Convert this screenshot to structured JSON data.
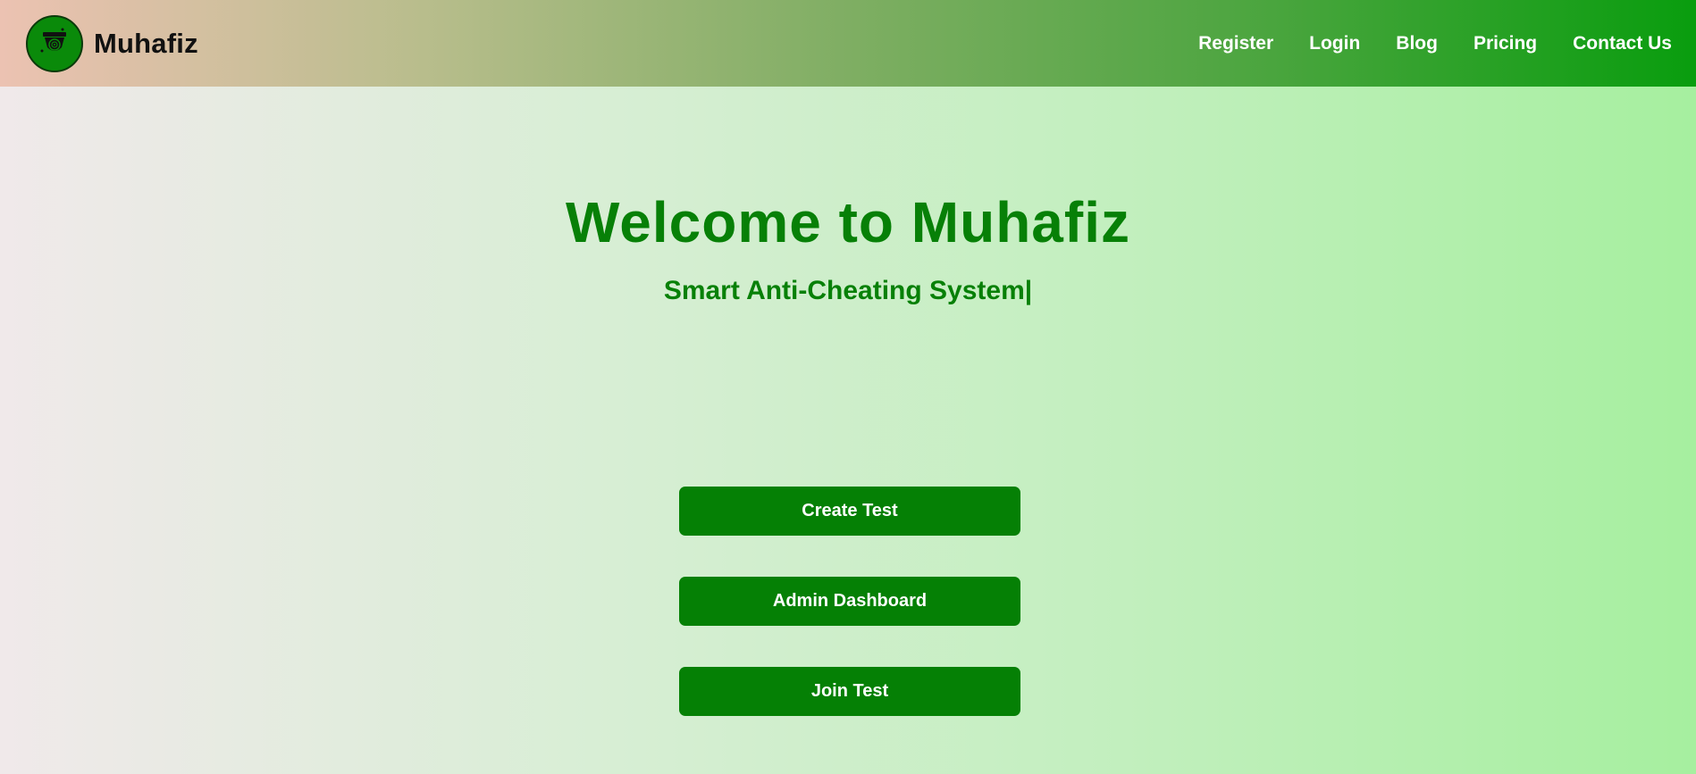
{
  "navbar": {
    "brand_name": "Muhafiz",
    "logo_icon": "camera-surveillance-icon",
    "links": [
      {
        "label": "Register"
      },
      {
        "label": "Login"
      },
      {
        "label": "Blog"
      },
      {
        "label": "Pricing"
      },
      {
        "label": "Contact Us"
      }
    ]
  },
  "hero": {
    "title": "Welcome to Muhafiz",
    "subtitle": "Smart Anti-Cheating System|"
  },
  "actions": {
    "create_test": "Create Test",
    "admin_dashboard": "Admin Dashboard",
    "join_test": "Join Test"
  },
  "colors": {
    "primary_green": "#058005",
    "title_green": "#078007",
    "nav_link_text": "#ffffff"
  }
}
